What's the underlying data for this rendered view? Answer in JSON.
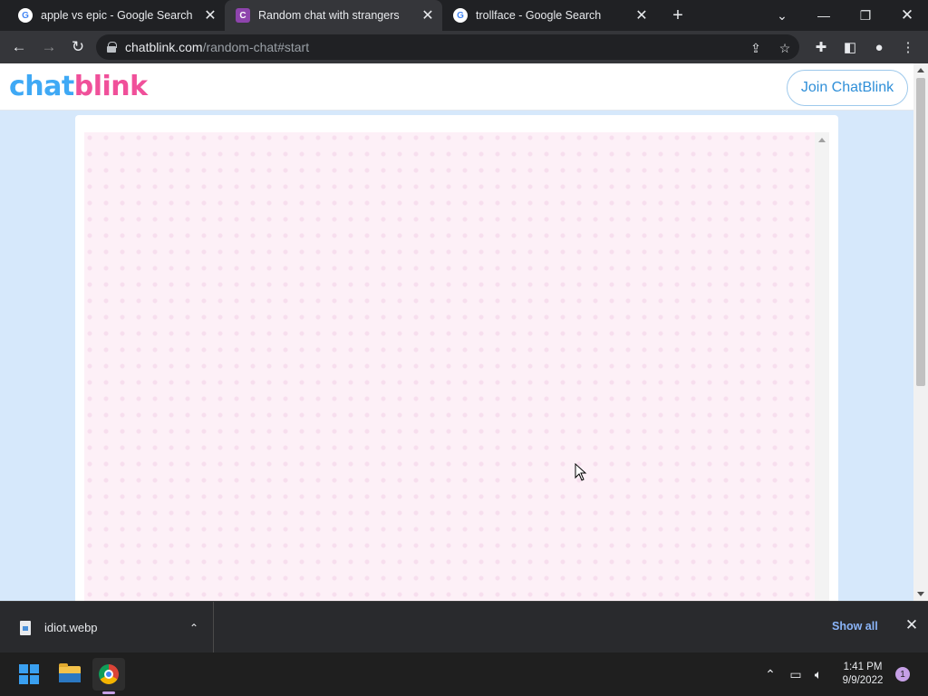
{
  "browser": {
    "tabs": [
      {
        "title": "apple vs epic - Google Search",
        "favicon": "google-icon",
        "active": false
      },
      {
        "title": "Random chat with strangers",
        "favicon": "chatblink-icon",
        "active": true
      },
      {
        "title": "trollface - Google Search",
        "favicon": "google-icon",
        "active": false
      }
    ],
    "url_host": "chatblink.com",
    "url_path": "/random-chat#start"
  },
  "site": {
    "logo_part1": "chat",
    "logo_part2": "blink",
    "join_button": "Join ChatBlink",
    "colors": {
      "logo_blue": "#3fa9f5",
      "logo_pink": "#f0509a",
      "chat_bg": "#fdf0f7"
    }
  },
  "downloads": {
    "file_name": "idiot.webp",
    "show_all": "Show all"
  },
  "taskbar": {
    "time": "1:41 PM",
    "date": "9/9/2022",
    "notification_count": "1"
  }
}
